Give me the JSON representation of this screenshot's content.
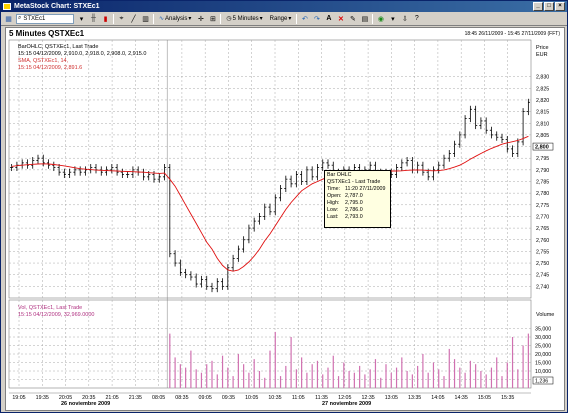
{
  "window": {
    "title": "MetaStock Chart: STXEc1",
    "buttons": [
      "_",
      "□",
      "×"
    ]
  },
  "toolbar": {
    "symbol": "STXEc1",
    "analysis_label": "Analysis",
    "interval_label": "5 Minutes",
    "range_label": "Range"
  },
  "chart": {
    "title": "5 Minutes QSTXEc1",
    "timestamp": "18:45 26/11/2009 - 15:45 27/11/2009 (FFT)",
    "price_axis_title": "Price",
    "price_axis_unit": "EUR",
    "volume_axis_title": "Volume",
    "bar_legend_name": "BarOHLC, QSTXEc1, Last Trade",
    "bar_legend_values": "15:15 04/12/2009, 2,910.0, 2,918.0, 2,908.0, 2,915.0",
    "sma_legend_name": "SMA, QSTXEc1, 14,",
    "sma_legend_values": "15:15 04/12/2009, 2,891.6",
    "vol_legend_name": "Vol, QSTXEc1, Last Trade",
    "vol_legend_values": "15:15 04/12/2009, 32,969.0000",
    "date_label_1": "26 noviembre 2009",
    "date_label_2": "27 noviembre 2009",
    "last_price_badge": "2,800",
    "last_volume_badge": "1,236",
    "colors": {
      "bars": "#000000",
      "sma": "#e01010",
      "volume": "#d070b0",
      "grid": "#a8a8a8",
      "legend_text": "#d03030",
      "vol_legend_text": "#b03080",
      "tooltip_bg": "#ffffe1"
    }
  },
  "tooltip": {
    "title": "Bar OHLC",
    "subtitle": "QSTXEc1 - Last Trade",
    "rows": [
      {
        "label": "Time:",
        "value": "11:20 27/11/2009"
      },
      {
        "label": "Open:",
        "value": "2,787.0"
      },
      {
        "label": "High:",
        "value": "2,795.0"
      },
      {
        "label": "Low:",
        "value": "2,786.0"
      },
      {
        "label": "Last:",
        "value": "2,793.0"
      }
    ]
  },
  "chart_data": {
    "type": "line",
    "title": "5 Minutes QSTXEc1",
    "ylabel": "Price EUR",
    "ylim": [
      2735,
      2832
    ],
    "y_ticks": [
      2740,
      2745,
      2750,
      2755,
      2760,
      2765,
      2770,
      2775,
      2780,
      2785,
      2790,
      2795,
      2800,
      2805,
      2810,
      2815,
      2820,
      2825,
      2830
    ],
    "y_tick_labels": [
      "2,740",
      "2,745",
      "2,750",
      "2,755",
      "2,760",
      "2,765",
      "2,770",
      "2,775",
      "2,780",
      "2,785",
      "2,790",
      "2,795",
      "2,800",
      "2,805",
      "2,810",
      "2,815",
      "2,820",
      "2,825",
      "2,830"
    ],
    "x_tick_labels": [
      "19:05",
      "19:35",
      "20:05",
      "20:35",
      "21:05",
      "21:35",
      "08:05",
      "08:35",
      "09:05",
      "09:35",
      "10:05",
      "10:35",
      "11:05",
      "11:35",
      "12:05",
      "12:35",
      "13:05",
      "13:35",
      "14:05",
      "14:35",
      "15:05",
      "15:35"
    ],
    "grid": true,
    "close": [
      2791,
      2792,
      2793,
      2792,
      2794,
      2795,
      2793,
      2792,
      2791,
      2789,
      2788,
      2789,
      2790,
      2789,
      2790,
      2791,
      2790,
      2789,
      2790,
      2791,
      2789,
      2788,
      2788,
      2790,
      2789,
      2787,
      2788,
      2786,
      2787,
      2791,
      2754,
      2750,
      2746,
      2745,
      2744,
      2741,
      2743,
      2740,
      2739,
      2742,
      2740,
      2748,
      2752,
      2756,
      2760,
      2765,
      2768,
      2770,
      2774,
      2772,
      2778,
      2782,
      2786,
      2784,
      2788,
      2785,
      2790,
      2787,
      2791,
      2793,
      2792,
      2789,
      2788,
      2790,
      2786,
      2791,
      2788,
      2790,
      2792,
      2789,
      2787,
      2789,
      2788,
      2791,
      2793,
      2794,
      2790,
      2792,
      2789,
      2787,
      2790,
      2792,
      2795,
      2797,
      2801,
      2805,
      2812,
      2816,
      2809,
      2811,
      2807,
      2805,
      2804,
      2803,
      2799,
      2797,
      2802,
      2815,
      2819
    ],
    "sma": [
      2791.5,
      2791.8,
      2792.0,
      2792.2,
      2792.4,
      2792.5,
      2792.6,
      2792.5,
      2792.3,
      2792.0,
      2791.7,
      2791.3,
      2790.9,
      2790.5,
      2790.3,
      2790.1,
      2789.9,
      2789.8,
      2789.7,
      2789.6,
      2789.5,
      2789.4,
      2789.3,
      2789.2,
      2789.1,
      2789.0,
      2788.8,
      2788.6,
      2788.5,
      2788.6,
      2786.0,
      2783.0,
      2779.0,
      2775.0,
      2771.0,
      2767.0,
      2763.0,
      2759.0,
      2756.0,
      2752.0,
      2749.0,
      2747.0,
      2746.5,
      2747.0,
      2748.5,
      2750.5,
      2753.0,
      2756.0,
      2759.5,
      2762.5,
      2766.0,
      2769.5,
      2773.0,
      2776.0,
      2778.5,
      2781.0,
      2782.5,
      2784.0,
      2785.0,
      2786.0,
      2787.0,
      2787.5,
      2788.0,
      2788.5,
      2788.8,
      2789.0,
      2789.2,
      2789.3,
      2789.5,
      2789.6,
      2789.6,
      2789.6,
      2789.5,
      2789.5,
      2789.6,
      2789.8,
      2789.9,
      2790.0,
      2789.9,
      2789.7,
      2789.6,
      2789.7,
      2790.0,
      2790.5,
      2791.2,
      2792.0,
      2793.2,
      2794.6,
      2795.8,
      2797.0,
      2798.2,
      2799.2,
      2800.1,
      2801.0,
      2801.6,
      2802.1,
      2802.6,
      2803.4,
      2804.4
    ],
    "volume_ylim": [
      0,
      40000
    ],
    "volume_ticks": [
      5000,
      10000,
      15000,
      20000,
      25000,
      30000,
      35000
    ],
    "volume_tick_labels": [
      "5,000",
      "10,000",
      "15,000",
      "20,000",
      "25,000",
      "30,000",
      "35,000"
    ],
    "volume": [
      0,
      0,
      0,
      0,
      0,
      0,
      0,
      0,
      0,
      0,
      0,
      0,
      0,
      0,
      0,
      0,
      0,
      0,
      0,
      0,
      0,
      0,
      0,
      0,
      0,
      0,
      0,
      0,
      0,
      0,
      32000,
      18000,
      14000,
      12000,
      22000,
      11000,
      9000,
      14000,
      16000,
      8000,
      19000,
      12000,
      7000,
      20000,
      14000,
      9000,
      17000,
      10000,
      6000,
      22000,
      33000,
      7000,
      13000,
      30000,
      11000,
      18000,
      9000,
      14000,
      16000,
      8000,
      12000,
      19000,
      7000,
      15000,
      10000,
      9000,
      13000,
      8000,
      11000,
      17000,
      6000,
      14000,
      9000,
      12000,
      18000,
      10000,
      8000,
      13000,
      20000,
      9000,
      15000,
      11000,
      7000,
      23000,
      17000,
      12000,
      9000,
      16000,
      14000,
      10000,
      8000,
      12000,
      18000,
      7000,
      15000,
      30000,
      11000,
      25000,
      32000
    ]
  }
}
